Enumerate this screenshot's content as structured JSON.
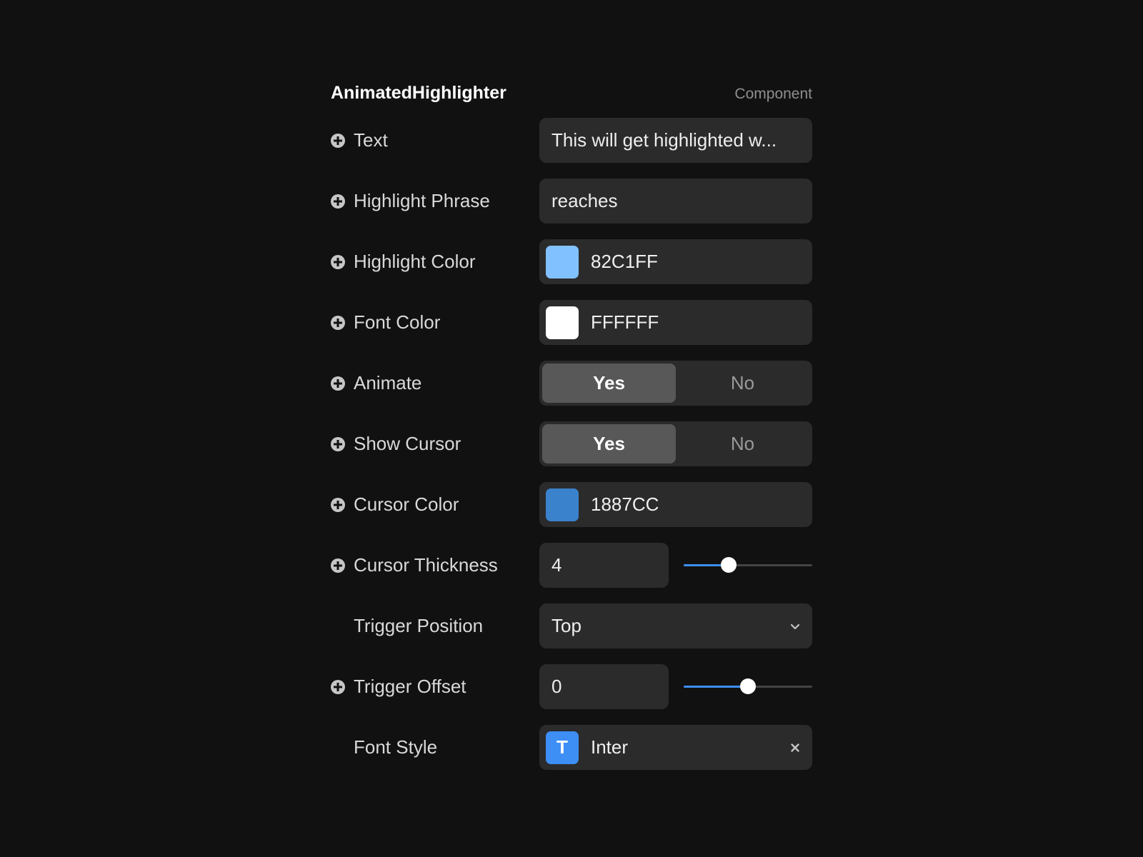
{
  "header": {
    "title": "AnimatedHighlighter",
    "subtitle": "Component"
  },
  "props": {
    "text": {
      "label": "Text",
      "value": "This will get highlighted w..."
    },
    "highlight_phrase": {
      "label": "Highlight Phrase",
      "value": "reaches"
    },
    "highlight_color": {
      "label": "Highlight Color",
      "value": "82C1FF",
      "swatch": "#82C1FF"
    },
    "font_color": {
      "label": "Font Color",
      "value": "FFFFFF",
      "swatch": "#FFFFFF"
    },
    "animate": {
      "label": "Animate",
      "yes": "Yes",
      "no": "No",
      "selected": "Yes"
    },
    "show_cursor": {
      "label": "Show Cursor",
      "yes": "Yes",
      "no": "No",
      "selected": "Yes"
    },
    "cursor_color": {
      "label": "Cursor Color",
      "value": "1887CC",
      "swatch": "#3a82cc"
    },
    "cursor_thickness": {
      "label": "Cursor Thickness",
      "value": "4",
      "slider_fraction": 0.35
    },
    "trigger_position": {
      "label": "Trigger Position",
      "value": "Top"
    },
    "trigger_offset": {
      "label": "Trigger Offset",
      "value": "0",
      "slider_fraction": 0.5
    },
    "font_style": {
      "label": "Font Style",
      "badge": "T",
      "value": "Inter"
    }
  },
  "icons": {
    "add": "plus-circle-icon",
    "dropdown": "chevron-down-icon",
    "clear": "close-icon"
  },
  "colors": {
    "accent": "#3d8ef5",
    "background": "#111111",
    "control_bg": "#2b2b2b"
  }
}
